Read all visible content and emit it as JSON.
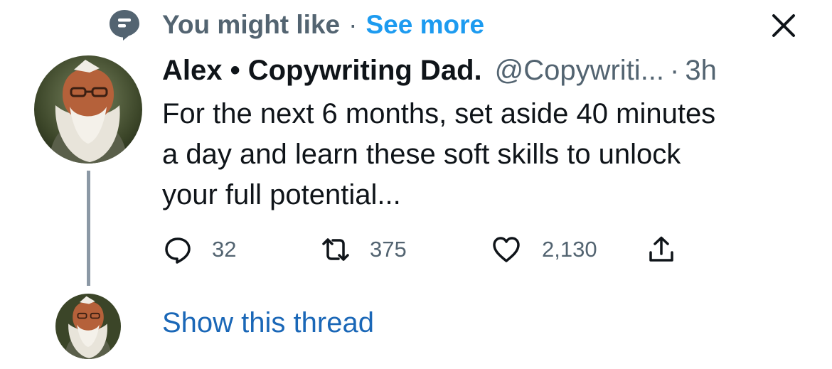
{
  "context": {
    "icon": "topic-bubble-icon",
    "label": "You might like",
    "separator": "·",
    "see_more": "See more"
  },
  "close_icon": "close-icon",
  "tweet": {
    "author_name": "Alex • Copywriting Dad.",
    "author_handle": "@Copywriti...",
    "separator": "·",
    "time": "3h",
    "text_lines": [
      "For the next 6 months, set aside 40 minutes",
      "a day and learn these soft skills to unlock",
      "your full potential..."
    ],
    "actions": {
      "reply": {
        "icon": "reply-icon",
        "count": "32"
      },
      "retweet": {
        "icon": "retweet-icon",
        "count": "375"
      },
      "like": {
        "icon": "heart-icon",
        "count": "2,130"
      },
      "share": {
        "icon": "share-icon"
      }
    }
  },
  "show_thread": "Show this thread",
  "colors": {
    "text_primary": "#0f1419",
    "text_secondary": "#536471",
    "link_blue": "#1d9bf0",
    "thread_line": "#8b98a5"
  }
}
